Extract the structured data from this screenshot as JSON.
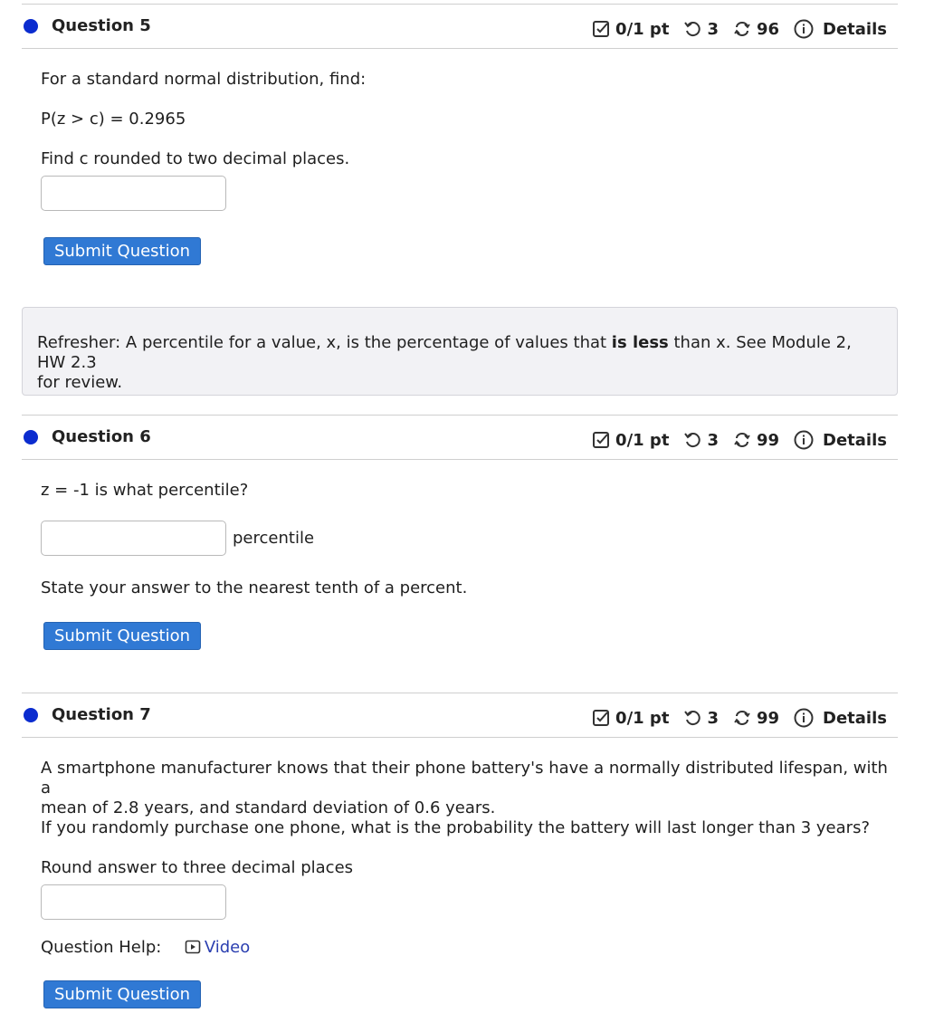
{
  "questions": [
    {
      "title": "Question 5",
      "score": "0/1 pt",
      "tries": "3",
      "attempts": "96",
      "details": "Details",
      "lines": [
        "For a standard normal distribution, find:",
        "P(z > c) = 0.2965",
        "Find c rounded to two decimal places."
      ],
      "submit_label": "Submit Question"
    },
    {
      "title": "Question 6",
      "score": "0/1 pt",
      "tries": "3",
      "attempts": "99",
      "details": "Details",
      "prompt": "z = -1 is what percentile?",
      "input_suffix": "percentile",
      "instruction": "State your answer to the nearest tenth of a percent.",
      "submit_label": "Submit Question"
    },
    {
      "title": "Question 7",
      "score": "0/1 pt",
      "tries": "3",
      "attempts": "99",
      "details": "Details",
      "paragraph_line1": "A smartphone manufacturer knows that their phone battery's have a normally distributed lifespan, with a",
      "paragraph_line2": "mean of 2.8 years, and standard deviation of 0.6 years.",
      "question": "If you randomly purchase one phone, what is the probability the battery will last longer than 3 years?",
      "round_note": "Round answer to three decimal places",
      "help_label": "Question Help:",
      "video_label": "Video",
      "submit_label": "Submit Question"
    }
  ],
  "refresher": {
    "prefix": "Refresher: A percentile for a value, x, is the percentage of values that ",
    "bold": "is less",
    "suffix": " than x. See Module 2, HW 2.3",
    "line2": "for review."
  },
  "colors": {
    "dot": "#0b2ccf",
    "submit": "#3079d4",
    "refresher_bg": "#f2f2f5",
    "link": "#2b3fb0"
  },
  "icons": [
    "checkbox-score-icon",
    "retry-icon",
    "attempts-icon",
    "info-icon",
    "video-play-icon"
  ]
}
